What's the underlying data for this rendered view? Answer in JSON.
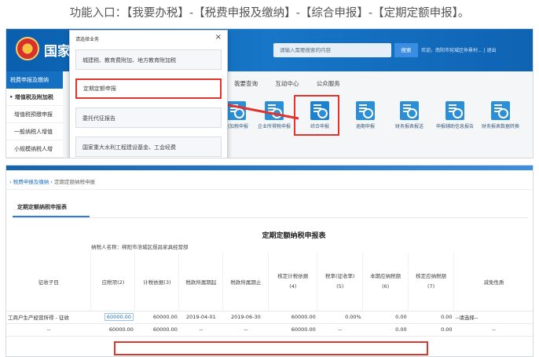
{
  "caption": "功能入口：【我要办税】-【税费申报及缴纳】-【综合申报】-【定期定额申报】。",
  "portal": {
    "brand": "国家",
    "search_placeholder": "请输入需要搜索的内容",
    "search_button": "搜索",
    "welcome": "欢迎，南阳市宛城区仲景村... | 退出",
    "nav": [
      "我要查询",
      "互动中心",
      "公众服务"
    ],
    "sidebar": {
      "head": "税费申报及缴纳",
      "items": [
        "• 增值税及附加税",
        "增值税预缴申报",
        "一般纳税人增值",
        "小规模纳税人增"
      ]
    },
    "tiles": [
      {
        "label": "附加税申报"
      },
      {
        "label": "企业所得税申报"
      },
      {
        "label": "综合申报"
      },
      {
        "label": "逾期申报"
      },
      {
        "label": "财务报表报送"
      },
      {
        "label": "申报辅助信息报告"
      },
      {
        "label": "财务报表数据转换"
      }
    ]
  },
  "modal": {
    "title": "请选择业务",
    "close": "×",
    "items": [
      "城建税、教育费附加、地方教育附加税",
      "定期定额申报",
      "委托代征报告",
      "国家重大水利工程建设基金、工会经费"
    ]
  },
  "form": {
    "breadcrumb": {
      "root": "税费申报及缴纳",
      "sep": "›",
      "current": "定期定额纳税申报"
    },
    "tab": "定期定额纳税申报表",
    "title": "定期定额纳税申报表",
    "taxpayer_label": "纳税人名称：",
    "taxpayer_name": "绵阳市涪城区煜昌家具经营部",
    "columns": [
      "征收子目",
      "应税项(2)",
      "计税依据(3)",
      "税款所属期起",
      "税款所属期止",
      "核定计税依据\n(4)",
      "税率(征收率)\n(5)",
      "本期应纳税额\n(6)",
      "核定应纳税额\n(7)",
      "减免性质"
    ],
    "rows": [
      [
        "工商户生产经营所得 - 征收",
        "60000.00",
        "60000.00",
        "2019-04-01",
        "2019-06-30",
        "60000.00",
        "0.00%",
        "0.00",
        "0.00",
        "--请选择--"
      ],
      [
        "--",
        "60000.00",
        "60000.00",
        "--",
        "--",
        "60000.00",
        "--",
        "0.00",
        "0.00",
        "--"
      ]
    ]
  },
  "colors": {
    "header_blue": "#1570c2",
    "highlight_red": "#e0342e",
    "link_blue": "#1e6fc0"
  }
}
